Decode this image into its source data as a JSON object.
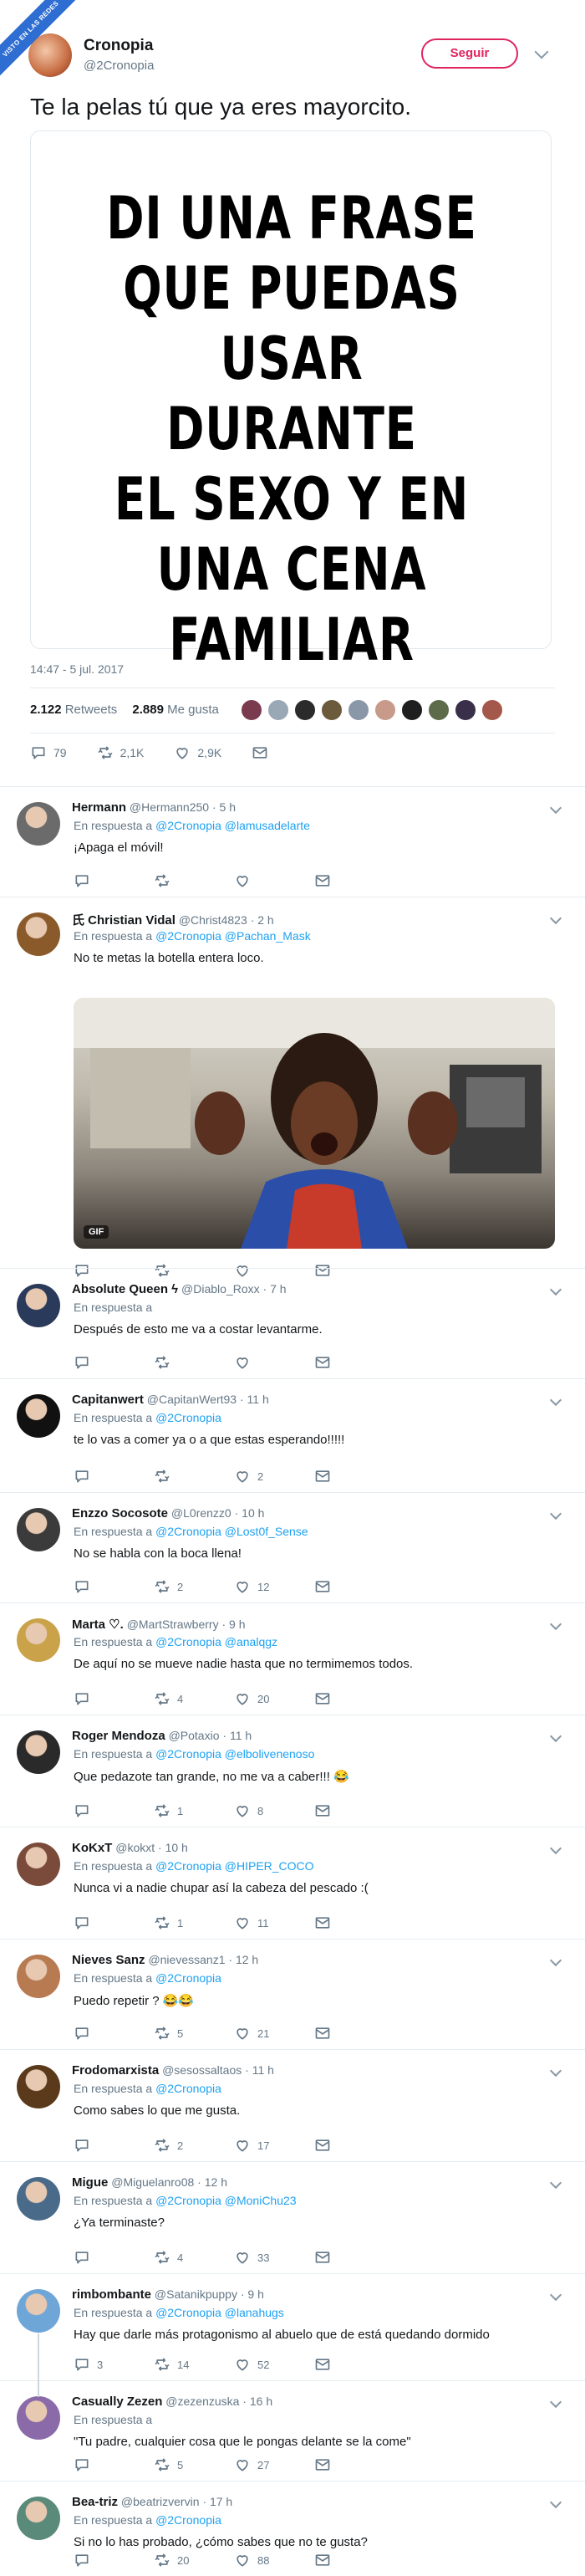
{
  "watermark": "VISTO EN LAS REDES",
  "main_tweet": {
    "name": "Cronopia",
    "handle": "@2Cronopia",
    "follow_label": "Seguir",
    "text": "Te la pelas tú que ya eres mayorcito.",
    "image_text_lines": [
      "DI UNA FRASE",
      "QUE PUEDAS",
      "USAR DURANTE",
      "EL SEXO Y EN",
      "UNA CENA",
      "FAMILIAR"
    ],
    "timestamp": "14:47 - 5 jul. 2017",
    "retweets_count": "2.122",
    "retweets_label": "Retweets",
    "likes_count": "2.889",
    "likes_label": "Me gusta",
    "actions": {
      "reply": "79",
      "retweet": "2,1K",
      "like": "2,9K"
    }
  },
  "in_reply_label": "En respuesta a",
  "gif_label": "GIF",
  "replies": [
    {
      "name": "Hermann",
      "handle": "@Hermann250",
      "time": "5 h",
      "mentions": "@2Cronopia @lamusadelarte",
      "text": "¡Apaga el móvil!",
      "reply": "",
      "retweet": "",
      "like": ""
    },
    {
      "name": "氏 Christian Vidal",
      "handle": "@Christ4823",
      "time": "2 h",
      "mentions": "@2Cronopia @Pachan_Mask",
      "text": "No te metas la botella entera loco.",
      "reply": "",
      "retweet": "",
      "like": ""
    },
    {
      "name": "Absolute Queen ϟ",
      "handle": "@Diablo_Roxx",
      "time": "7 h",
      "mentions": "",
      "text": "Después de esto me va a costar levantarme.",
      "reply": "",
      "retweet": "",
      "like": ""
    },
    {
      "name": "Capitanwert",
      "handle": "@CapitanWert93",
      "time": "11 h",
      "mentions": "@2Cronopia",
      "text": "te lo vas a comer ya o a que estas esperando!!!!!",
      "reply": "",
      "retweet": "",
      "like": "2"
    },
    {
      "name": "Enzzo Socosote",
      "handle": "@L0renzz0",
      "time": "10 h",
      "mentions": "@2Cronopia @Lost0f_Sense",
      "text": "No se habla con la boca llena!",
      "reply": "",
      "retweet": "2",
      "like": "12"
    },
    {
      "name": "Marta ♡.",
      "handle": "@MartStrawberry",
      "time": "9 h",
      "mentions": "@2Cronopia @analqgz",
      "text": "De aquí no se mueve nadie hasta que no termimemos todos.",
      "reply": "",
      "retweet": "4",
      "like": "20"
    },
    {
      "name": "Roger Mendoza",
      "handle": "@Potaxio",
      "time": "11 h",
      "mentions": "@2Cronopia @elbolivenenoso",
      "text": "Que pedazote tan grande, no me va a caber!!! 😂",
      "reply": "",
      "retweet": "1",
      "like": "8"
    },
    {
      "name": "KoKxT",
      "handle": "@kokxt",
      "time": "10 h",
      "mentions": "@2Cronopia @HIPER_COCO",
      "text": "Nunca vi a nadie chupar así la cabeza del pescado :(",
      "reply": "",
      "retweet": "1",
      "like": "11"
    },
    {
      "name": "Nieves Sanz",
      "handle": "@nievessanz1",
      "time": "12 h",
      "mentions": "@2Cronopia",
      "text": "Puedo repetir ? 😂😂",
      "reply": "",
      "retweet": "5",
      "like": "21"
    },
    {
      "name": "Frodomarxista",
      "handle": "@sesossaltaos",
      "time": "11 h",
      "mentions": "@2Cronopia",
      "text": "Como sabes lo que me gusta.",
      "reply": "",
      "retweet": "2",
      "like": "17"
    },
    {
      "name": "Migue",
      "handle": "@Miguelanro08",
      "time": "12 h",
      "mentions": "@2Cronopia @MoniChu23",
      "text": "¿Ya terminaste?",
      "reply": "",
      "retweet": "4",
      "like": "33"
    },
    {
      "name": "rimbombante",
      "handle": "@Satanikpuppy",
      "time": "9 h",
      "mentions": "@2Cronopia @lanahugs",
      "text": "Hay que darle más protagonismo al abuelo que de está quedando dormido",
      "reply": "3",
      "retweet": "14",
      "like": "52"
    },
    {
      "name": "Casually Zezen",
      "handle": "@zezenzuska",
      "time": "16 h",
      "mentions": "",
      "text": "\"Tu padre, cualquier cosa que le pongas delante se la come\"",
      "reply": "",
      "retweet": "5",
      "like": "27"
    },
    {
      "name": "Bea-triz",
      "handle": "@beatrizvervin",
      "time": "17 h",
      "mentions": "@2Cronopia",
      "text": "Si no lo has probado, ¿cómo sabes que no te gusta?",
      "reply": "",
      "retweet": "20",
      "like": "88"
    }
  ],
  "colors": {
    "accent": "#1da1f2",
    "follow": "#e0245e",
    "text": "#14171a",
    "secondary": "#657786",
    "border": "#e6ecf0"
  },
  "icons": [
    "reply-icon",
    "retweet-icon",
    "like-icon",
    "message-icon",
    "chevron-down-icon"
  ]
}
